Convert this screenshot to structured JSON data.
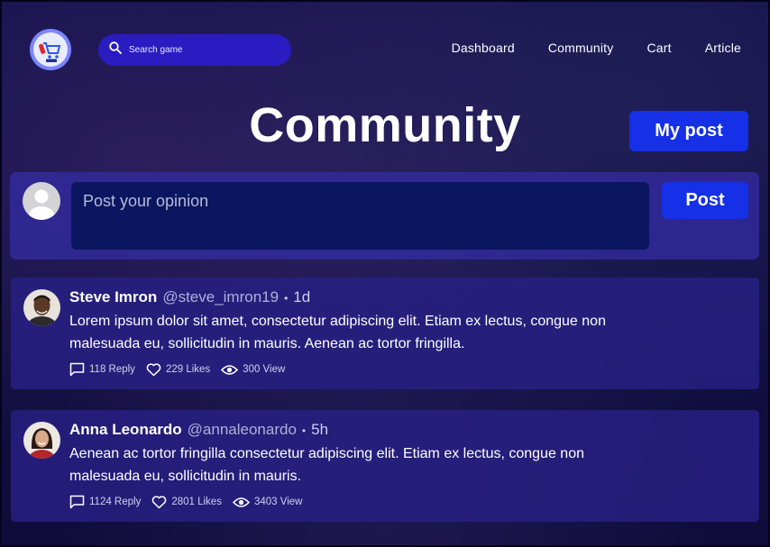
{
  "header": {
    "search_placeholder": "Search game",
    "nav": [
      "Dashboard",
      "Community",
      "Cart",
      "Article"
    ]
  },
  "page": {
    "title": "Community",
    "my_post_label": "My post"
  },
  "composer": {
    "placeholder": "Post your opinion",
    "post_label": "Post"
  },
  "posts": [
    {
      "name": "Steve Imron",
      "handle": "@steve_imron19",
      "dot": "•",
      "time": "1d",
      "text": "Lorem ipsum dolor sit amet, consectetur adipiscing elit. Etiam ex lectus, congue non malesuada eu, sollicitudin in mauris. Aenean ac tortor fringilla.",
      "replies": "118 Reply",
      "likes": "229 Likes",
      "views": "300 View"
    },
    {
      "name": "Anna Leonardo",
      "handle": "@annaleonardo",
      "dot": "•",
      "time": "5h",
      "text": "Aenean ac tortor fringilla consectetur adipiscing elit. Etiam ex lectus, congue non malesuada eu, sollicitudin in mauris.",
      "replies": "1124 Reply",
      "likes": "2801 Likes",
      "views": "3403 View"
    }
  ],
  "colors": {
    "accent": "#1530e6",
    "search_bg": "#2a1cc0",
    "panel": "#342ca8",
    "input_bg": "#0a1660"
  }
}
